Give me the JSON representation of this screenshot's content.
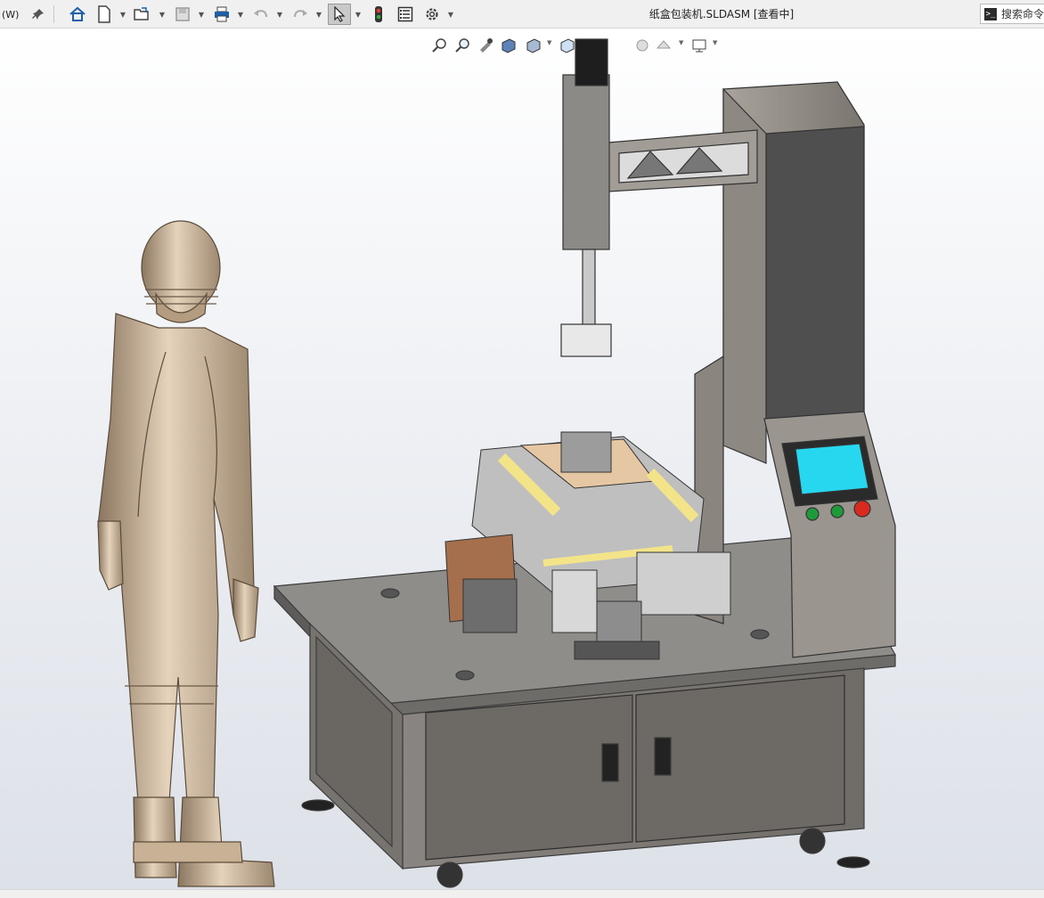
{
  "titlebar": {
    "menu_label": "(W)",
    "document_title": "纸盒包装机.SLDASM [查看中]",
    "search_placeholder": "搜索命令",
    "search_terminal_glyph": ">_"
  },
  "toolbar": {
    "icons": [
      "home-icon",
      "new-document-icon",
      "open-icon",
      "save-icon",
      "print-icon",
      "undo-icon",
      "redo-icon",
      "select-icon",
      "rebuild-icon",
      "file-properties-icon",
      "options-icon"
    ]
  },
  "heads_up_toolbar": {
    "icons": [
      "zoom-to-fit-icon",
      "zoom-to-area-icon",
      "previous-view-icon",
      "section-view-icon",
      "view-orientation-icon",
      "display-style-icon",
      "hide-show-icon",
      "edit-appearance-icon",
      "apply-scene-icon",
      "view-settings-icon"
    ]
  },
  "colors": {
    "viewport_top": "#ffffff",
    "viewport_bottom": "#dfe3ea",
    "machine_gray": "#7f7b76",
    "machine_dark": "#4d4d4d",
    "accent_yellow": "#f3e48a",
    "screen_cyan": "#27d7ef",
    "mannequin": "#cdb79a",
    "cardboard": "#c9a07a"
  }
}
